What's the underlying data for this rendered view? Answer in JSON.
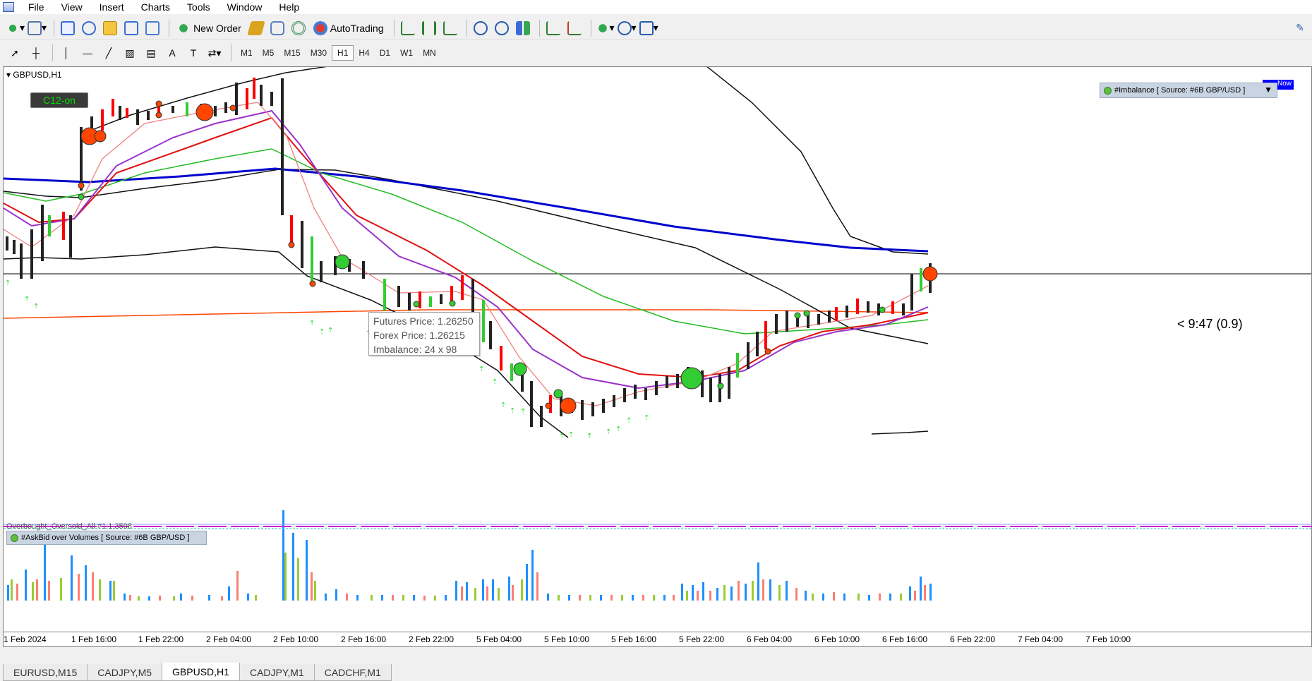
{
  "menu": {
    "items": [
      "File",
      "View",
      "Insert",
      "Charts",
      "Tools",
      "Window",
      "Help"
    ]
  },
  "toolbar": {
    "new_order": "New Order",
    "auto_trading": "AutoTrading"
  },
  "timeframes": [
    "M1",
    "M5",
    "M15",
    "M30",
    "H1",
    "H4",
    "D1",
    "W1",
    "MN"
  ],
  "active_timeframe": "H1",
  "chart": {
    "symbol": "GBPUSD,H1",
    "c12_label": "C12-on",
    "imbalance_panel": "#Imbalance [ Source: #6B GBP/USD ]",
    "blue_tag": "Now",
    "tooltip": {
      "futures": "Futures Price: 1.26250",
      "forex": "Forex Price: 1.26215",
      "imbalance": "Imbalance: 24 x 98"
    },
    "timer": "< 9:47 (0.9)",
    "osc_label": "Overbought_Oversold_All #1 1.3598",
    "askbid_panel": "#AskBid over Volumes [ Source: #6B GBP/USD ]"
  },
  "time_axis": [
    "1 Feb 2024",
    "1 Feb 16:00",
    "1 Feb 22:00",
    "2 Feb 04:00",
    "2 Feb 10:00",
    "2 Feb 16:00",
    "2 Feb 22:00",
    "5 Feb 04:00",
    "5 Feb 10:00",
    "5 Feb 16:00",
    "5 Feb 22:00",
    "6 Feb 04:00",
    "6 Feb 10:00",
    "6 Feb 16:00",
    "6 Feb 22:00",
    "7 Feb 04:00",
    "7 Feb 10:00"
  ],
  "tabs": [
    "EURUSD,M15",
    "CADJPY,M5",
    "GBPUSD,H1",
    "CADJPY,M1",
    "CADCHF,M1"
  ],
  "active_tab": "GBPUSD,H1",
  "colors": {
    "bull": "#32cd32",
    "bear": "#ff0000",
    "bigRed": "#ff4500",
    "bigGreen": "#32cd32",
    "ema_blue": "#0000cd",
    "ema_green": "#22bb22",
    "ema_red": "#e01010",
    "ema_purple": "#9932cc",
    "ema_pink": "#f08080",
    "level_orange": "#ff4500"
  }
}
